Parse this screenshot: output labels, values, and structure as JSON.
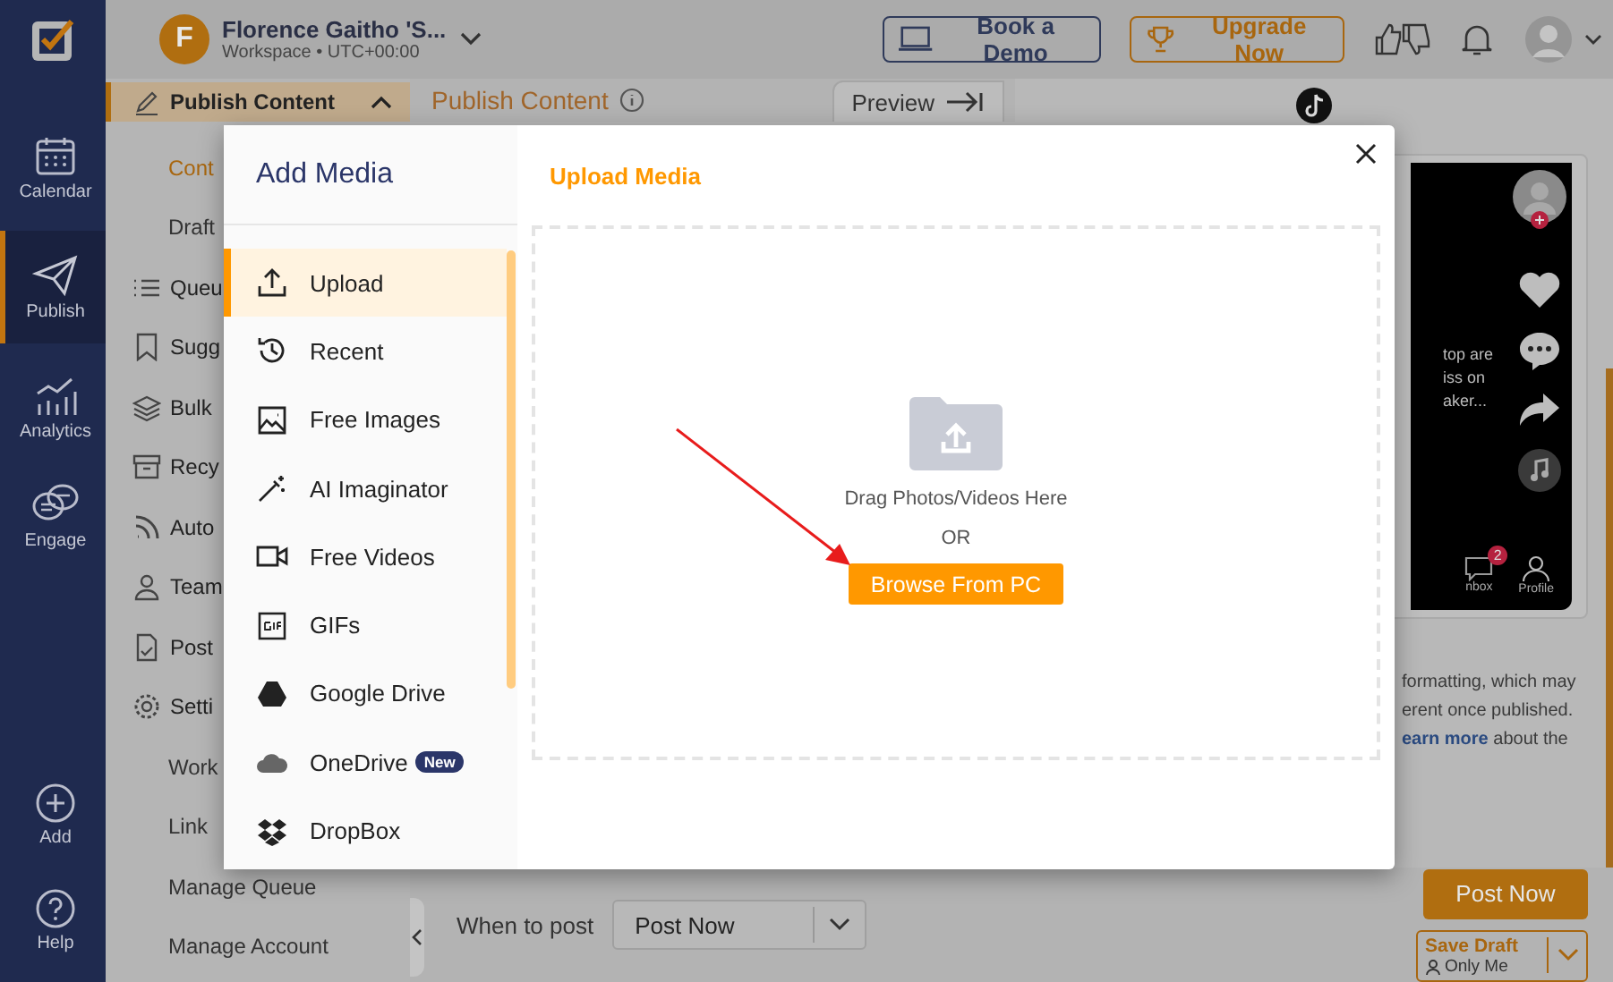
{
  "rail": {
    "items": [
      {
        "label": "Calendar",
        "selected": false
      },
      {
        "label": "Publish",
        "selected": true
      },
      {
        "label": "Analytics",
        "selected": false
      },
      {
        "label": "Engage",
        "selected": false
      }
    ],
    "bottom": [
      {
        "label": "Add"
      },
      {
        "label": "Help"
      }
    ]
  },
  "topbar": {
    "initial": "F",
    "workspace": "Florence Gaitho 'S...",
    "workspace_sub": "Workspace • UTC+00:00",
    "buttons": [
      {
        "label": "Book a Demo",
        "kind": "demo"
      },
      {
        "label": "Upgrade Now",
        "kind": "upgrade"
      }
    ]
  },
  "sidebar": {
    "items": [
      {
        "label": "Publish Content",
        "expanded": true,
        "children": [
          {
            "label": "Cont",
            "selected": true
          },
          {
            "label": "Draft",
            "selected": false
          }
        ]
      },
      {
        "label": "Queu"
      },
      {
        "label": "Sugg"
      },
      {
        "label": "Bulk"
      },
      {
        "label": "Recy"
      },
      {
        "label": "Auto"
      },
      {
        "label": "Team"
      },
      {
        "label": "Post"
      },
      {
        "label": "Setti",
        "children": [
          {
            "label": "Work",
            "selected": false
          },
          {
            "label": "Link",
            "selected": false
          },
          {
            "label": "Manage Queue",
            "selected": false
          },
          {
            "label": "Manage Account",
            "selected": false
          }
        ]
      }
    ]
  },
  "editor": {
    "title": "Publish Content",
    "preview_tab": "Preview"
  },
  "phone": {
    "caption": [
      "top are",
      "iss on",
      "aker..."
    ],
    "nav": [
      {
        "label": "nbox",
        "badge": "2"
      },
      {
        "label": "Profile"
      }
    ]
  },
  "note": {
    "lines": [
      "formatting, which may",
      "erent once published."
    ],
    "link": "earn more",
    "after_link": " about the"
  },
  "bottom_bar": {
    "when_label": "When to post",
    "when_value": "Post Now",
    "post_button": "Post Now",
    "save_button": "Save Draft",
    "save_audience": "Only Me"
  },
  "modal": {
    "title": "Add Media",
    "heading": "Upload Media",
    "sources": [
      {
        "label": "Upload",
        "selected": true
      },
      {
        "label": "Recent",
        "selected": false
      },
      {
        "label": "Free Images",
        "selected": false
      },
      {
        "label": "AI Imaginator",
        "selected": false
      },
      {
        "label": "Free Videos",
        "selected": false
      },
      {
        "label": "GIFs",
        "selected": false
      },
      {
        "label": "Google Drive",
        "selected": false
      },
      {
        "label": "OneDrive",
        "selected": false,
        "badge": "New"
      },
      {
        "label": "DropBox",
        "selected": false
      }
    ],
    "drop_text": "Drag Photos/Videos Here",
    "or_text": "OR",
    "browse_button": "Browse From PC"
  }
}
